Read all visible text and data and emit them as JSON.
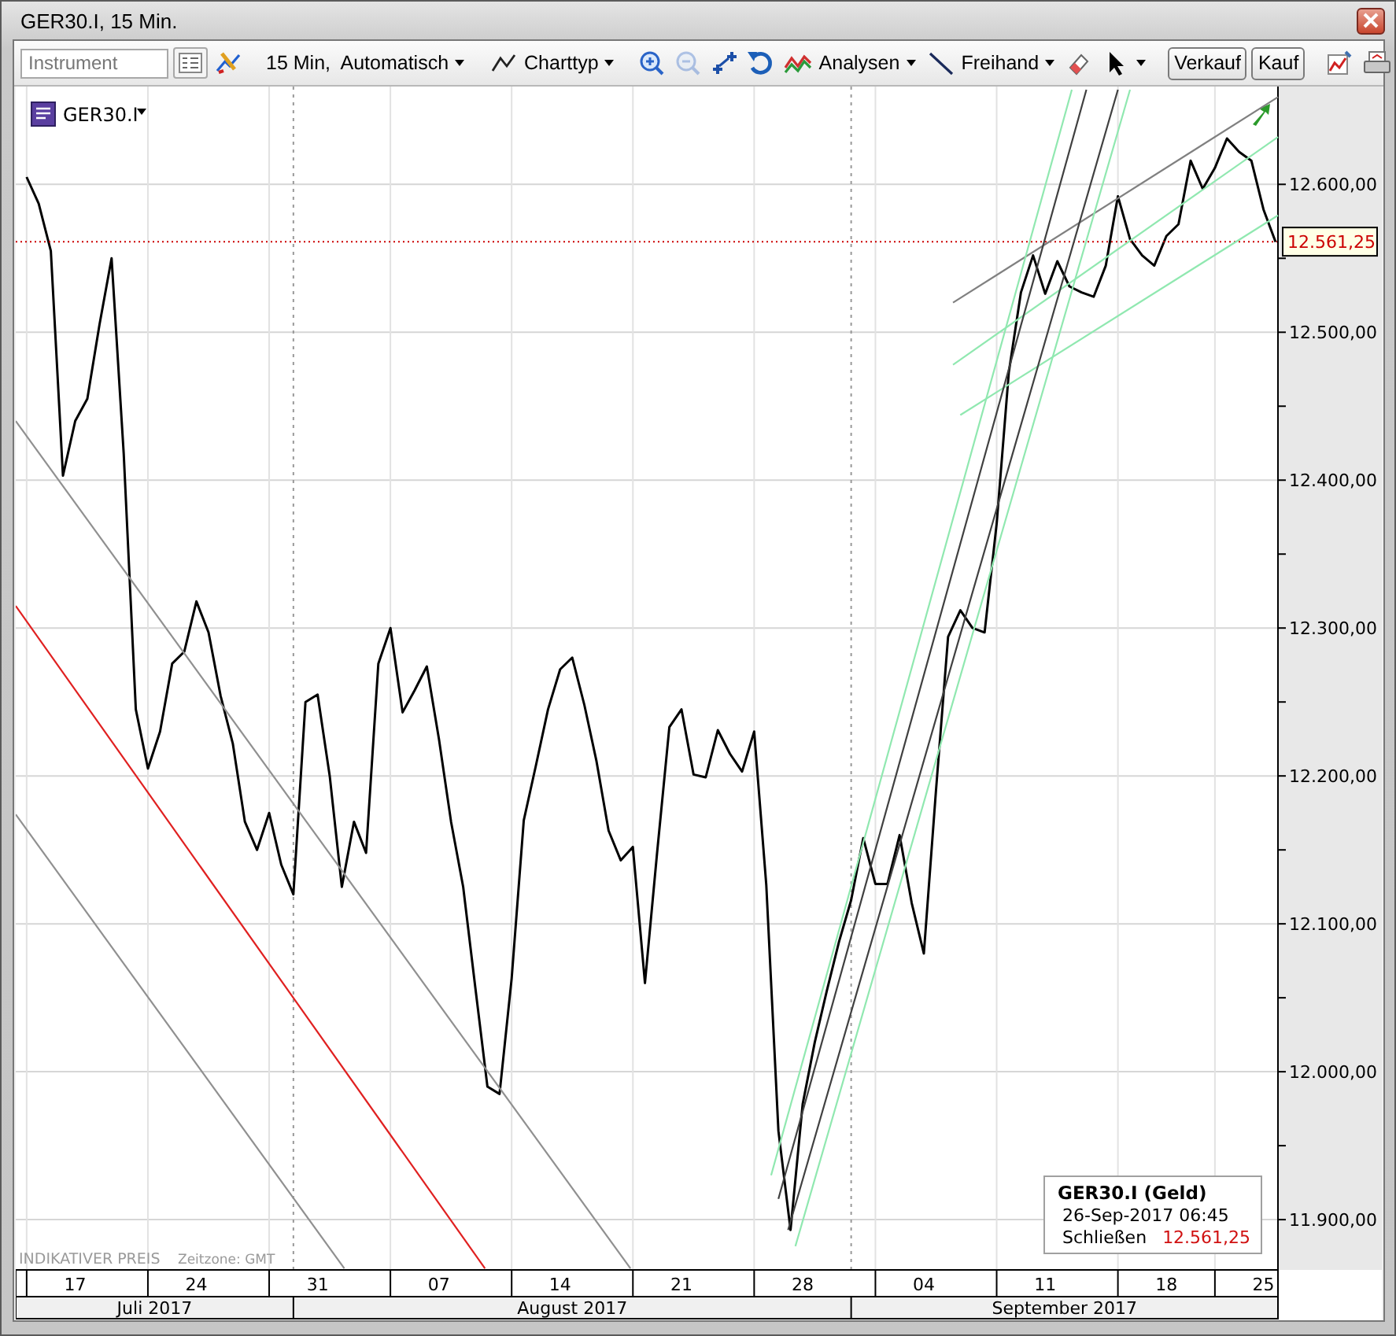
{
  "window": {
    "title": "GER30.I, 15 Min."
  },
  "toolbar": {
    "instrument_field": {
      "placeholder": "Instrument"
    },
    "interval_menu": {
      "label": "15 Min,  Automatisch"
    },
    "chart_type_menu": {
      "label": "Charttyp"
    },
    "zoom_out": {
      "disabled": true
    },
    "analyses_menu": {
      "label": "Analysen"
    },
    "freehand_menu": {
      "label": "Freihand"
    },
    "sell_button": {
      "label": "Verkauf"
    },
    "buy_button": {
      "label": "Kauf"
    }
  },
  "chart": {
    "chart_data": {
      "type": "line",
      "categories": [
        null,
        null,
        null,
        null,
        "17",
        null,
        null,
        null,
        null,
        null,
        null,
        null,
        null,
        null,
        "24",
        null,
        null,
        null,
        null,
        null,
        null,
        null,
        null,
        null,
        "31",
        null,
        null,
        null,
        null,
        null,
        null,
        null,
        null,
        null,
        "07",
        null,
        null,
        null,
        null,
        null,
        null,
        null,
        null,
        null,
        "14",
        null,
        null,
        null,
        null,
        null,
        null,
        null,
        null,
        null,
        "21",
        null,
        null,
        null,
        null,
        null,
        null,
        null,
        null,
        null,
        "28",
        null,
        null,
        null,
        null,
        null,
        null,
        null,
        null,
        null,
        "04",
        null,
        null,
        null,
        null,
        null,
        null,
        null,
        null,
        null,
        "11",
        null,
        null,
        null,
        null,
        null,
        null,
        null,
        null,
        null,
        "18",
        null,
        null,
        null,
        null,
        null,
        null,
        null,
        "25",
        null
      ],
      "series": [
        {
          "name": "GER30.I",
          "color": "#000000",
          "values": [
            12605,
            12587,
            12555,
            12403,
            12440,
            12455,
            12505,
            12550,
            12418,
            12245,
            12205,
            12230,
            12276,
            12284,
            12318,
            12297,
            12254,
            12222,
            12169,
            12150,
            12175,
            12140,
            12120,
            12250,
            12255,
            12200,
            12125,
            12169,
            12148,
            12276,
            12300,
            12243,
            12258,
            12274,
            12225,
            12169,
            12125,
            12057,
            11990,
            11985,
            12063,
            12170,
            12207,
            12245,
            12272,
            12280,
            12248,
            12210,
            12163,
            12143,
            12152,
            12060,
            12148,
            12233,
            12245,
            12201,
            12199,
            12231,
            12215,
            12203,
            12230,
            12126,
            11960,
            11893,
            11978,
            12020,
            12055,
            12088,
            12116,
            12158,
            12127,
            12127,
            12160,
            12114,
            12080,
            12190,
            12294,
            12312,
            12300,
            12297,
            12371,
            12473,
            12527,
            12552,
            12526,
            12548,
            12531,
            12527,
            12524,
            12545,
            12592,
            12563,
            12552,
            12545,
            12565,
            12573,
            12616,
            12597,
            12611,
            12631,
            12622,
            12616,
            12583,
            12561
          ]
        }
      ],
      "ylim": [
        11866,
        12664
      ],
      "grid": true,
      "ref_lines": [
        {
          "axis": "y",
          "value": 12561.25,
          "label": "12.561,25",
          "color": "#cc0000"
        }
      ],
      "yticks": [
        {
          "value": 11900,
          "label": "11.900,00"
        },
        {
          "value": 12000,
          "label": "12.000,00"
        },
        {
          "value": 12100,
          "label": "12.100,00"
        },
        {
          "value": 12200,
          "label": "12.200,00"
        },
        {
          "value": 12300,
          "label": "12.300,00"
        },
        {
          "value": 12400,
          "label": "12.400,00"
        },
        {
          "value": 12500,
          "label": "12.500,00"
        },
        {
          "value": 12600,
          "label": "12.600,00"
        }
      ]
    },
    "x_axis": {
      "months": [
        {
          "label": "Juli 2017"
        },
        {
          "label": "August 2017"
        },
        {
          "label": "September 2017"
        }
      ]
    }
  },
  "footer": {
    "price_note": "INDIKATIVER PREIS",
    "timezone": "Zeitzone: GMT"
  },
  "info_box": {
    "title": "GER30.I (Geld)",
    "timestamp": "26-Sep-2017 06:45",
    "field_label": "Schließen",
    "field_value": "12.561,25"
  }
}
